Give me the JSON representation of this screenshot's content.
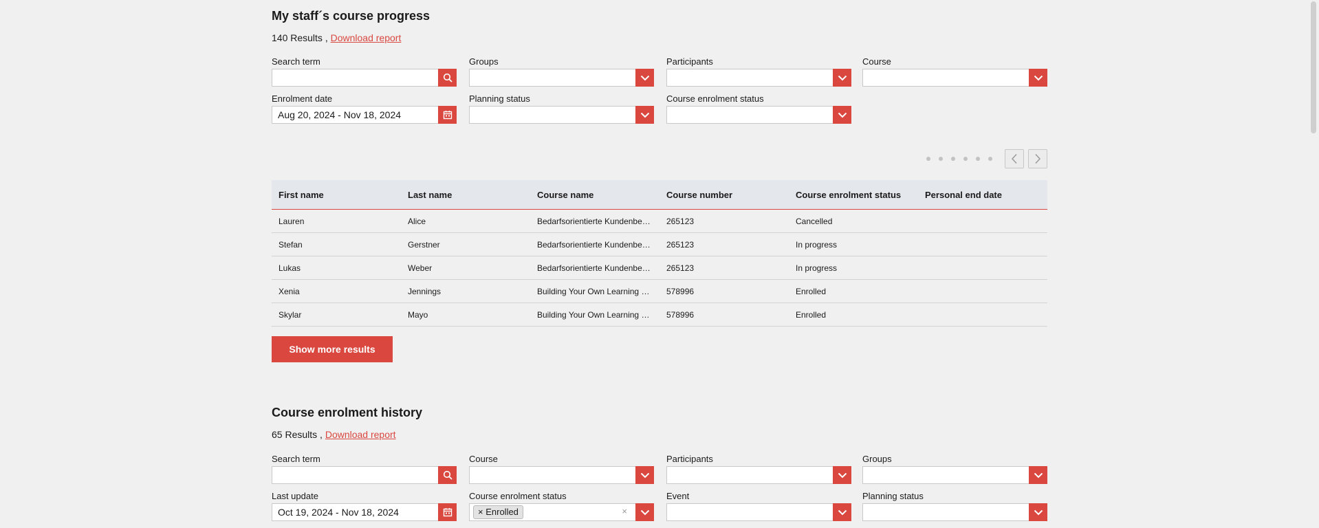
{
  "progress": {
    "title": "My staff´s course progress",
    "results_count": "140 Results ,",
    "download_link": "Download report",
    "filters": {
      "search_term": {
        "label": "Search term",
        "value": ""
      },
      "groups": {
        "label": "Groups",
        "value": ""
      },
      "participants": {
        "label": "Participants",
        "value": ""
      },
      "course": {
        "label": "Course",
        "value": ""
      },
      "enrolment_date": {
        "label": "Enrolment date",
        "value": "Aug 20, 2024 - Nov 18, 2024"
      },
      "planning_status": {
        "label": "Planning status",
        "value": ""
      },
      "course_enrolment_status": {
        "label": "Course enrolment status",
        "value": ""
      }
    },
    "pagination": {
      "dots": 6
    },
    "table": {
      "columns": [
        "First name",
        "Last name",
        "Course name",
        "Course number",
        "Course enrolment status",
        "Personal end date"
      ],
      "rows": [
        [
          "Lauren",
          "Alice",
          "Bedarfsorientierte Kundenberatung",
          "265123",
          "Cancelled",
          ""
        ],
        [
          "Stefan",
          "Gerstner",
          "Bedarfsorientierte Kundenberatung",
          "265123",
          "In progress",
          ""
        ],
        [
          "Lukas",
          "Weber",
          "Bedarfsorientierte Kundenberatung",
          "265123",
          "In progress",
          ""
        ],
        [
          "Xenia",
          "Jennings",
          "Building Your Own Learning Culture",
          "578996",
          "Enrolled",
          ""
        ],
        [
          "Skylar",
          "Mayo",
          "Building Your Own Learning Culture",
          "578996",
          "Enrolled",
          ""
        ]
      ]
    },
    "show_more": "Show more results"
  },
  "history": {
    "title": "Course enrolment history",
    "results_count": "65 Results ,",
    "download_link": "Download report",
    "filters": {
      "search_term": {
        "label": "Search term",
        "value": ""
      },
      "course": {
        "label": "Course",
        "value": ""
      },
      "participants": {
        "label": "Participants",
        "value": ""
      },
      "groups": {
        "label": "Groups",
        "value": ""
      },
      "last_update": {
        "label": "Last update",
        "value": "Oct 19, 2024 - Nov 18, 2024"
      },
      "course_enrolment_status": {
        "label": "Course enrolment status",
        "chip": "Enrolled",
        "chip_remove": "×",
        "clear": "×"
      },
      "event": {
        "label": "Event",
        "value": ""
      },
      "planning_status": {
        "label": "Planning status",
        "value": ""
      }
    }
  },
  "colors": {
    "accent": "#d9473f",
    "background": "#f0f0f0",
    "table_header": "#e4e7ec"
  },
  "icons": {
    "search": "search-icon",
    "calendar": "calendar-icon",
    "dropdown": "chevron-down-icon",
    "prev": "chevron-left-icon",
    "next": "chevron-right-icon"
  }
}
